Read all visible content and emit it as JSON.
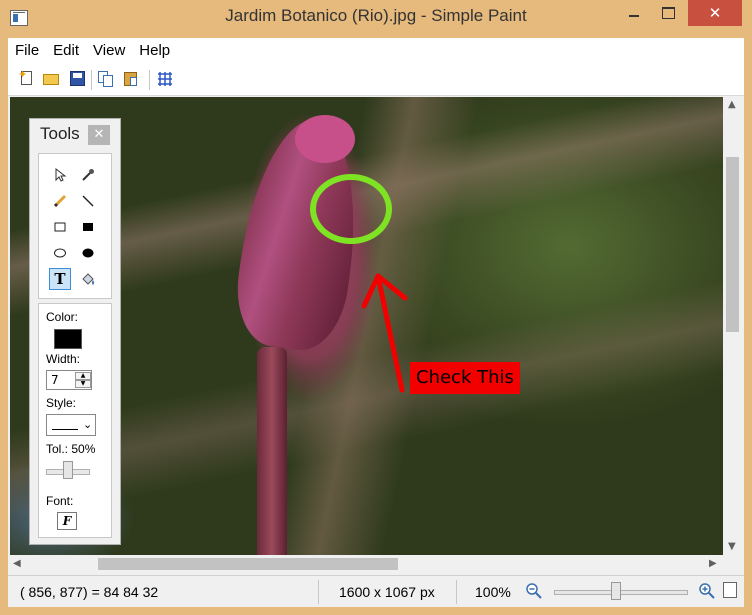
{
  "window": {
    "title": "Jardim Botanico (Rio).jpg - Simple Paint"
  },
  "menu": {
    "file": "File",
    "edit": "Edit",
    "view": "View",
    "help": "Help"
  },
  "toolbar": {
    "icons": [
      "new-file-icon",
      "open-folder-icon",
      "save-icon",
      "copy-icon",
      "paste-icon",
      "grid-icon"
    ]
  },
  "canvas": {
    "annotation_text": "Check This",
    "annotation_colors": {
      "circle": "#7ee323",
      "arrow": "#f20000",
      "label_bg": "#f20000"
    }
  },
  "tools_panel": {
    "title": "Tools",
    "close_glyph": "✕",
    "tools": [
      "select",
      "eyedropper",
      "pencil",
      "line",
      "rectangle",
      "filled-rectangle",
      "ellipse",
      "filled-ellipse",
      "text",
      "fill"
    ],
    "selected_tool": "text",
    "text_tool_glyph": "T",
    "color_label": "Color:",
    "current_color": "#000000",
    "width_label": "Width:",
    "width_value": "7",
    "style_label": "Style:",
    "tolerance_label": "Tol.: 50%",
    "tolerance_value": 0.5,
    "font_label": "Font:",
    "font_glyph": "F"
  },
  "status": {
    "coords": "( 856,  877) =  84  84  32",
    "dimensions": "1600 x 1067 px",
    "zoom": "100%",
    "zoom_fraction": 0.45
  },
  "colors": {
    "titlebar": "#e6ba7d",
    "close_button": "#c7503f",
    "selection": "#cce4f7"
  }
}
